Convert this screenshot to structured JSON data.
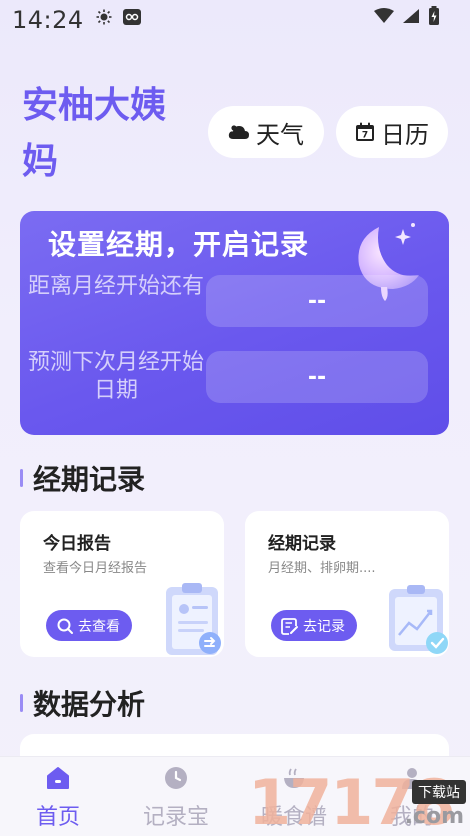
{
  "status_bar": {
    "time": "14:24"
  },
  "header": {
    "title": "安柚大姨妈",
    "weather_label": "天气",
    "calendar_label": "日历"
  },
  "period_card": {
    "title": "设置经期，开启记录",
    "row1_label": "距离月经开始还有",
    "row1_value": "--",
    "row2_label": "预测下次月经开始日期",
    "row2_value": "--"
  },
  "section_period": {
    "title": "经期记录"
  },
  "card_today": {
    "title": "今日报告",
    "subtitle": "查看今日月经报告",
    "button": "去查看"
  },
  "card_record": {
    "title": "经期记录",
    "subtitle": "月经期、排卵期....",
    "button": "去记录"
  },
  "section_analysis": {
    "title": "数据分析"
  },
  "tabs": [
    {
      "label": "首页"
    },
    {
      "label": "记录宝"
    },
    {
      "label": "暖食谱"
    },
    {
      "label": "我的"
    }
  ],
  "watermark": {
    "big": "17178",
    "tag": "下载站",
    "suffix": ".com"
  },
  "colors": {
    "accent": "#6d5cf0",
    "card_gradient_start": "#7b6cf2",
    "card_gradient_end": "#5f4ee9"
  }
}
